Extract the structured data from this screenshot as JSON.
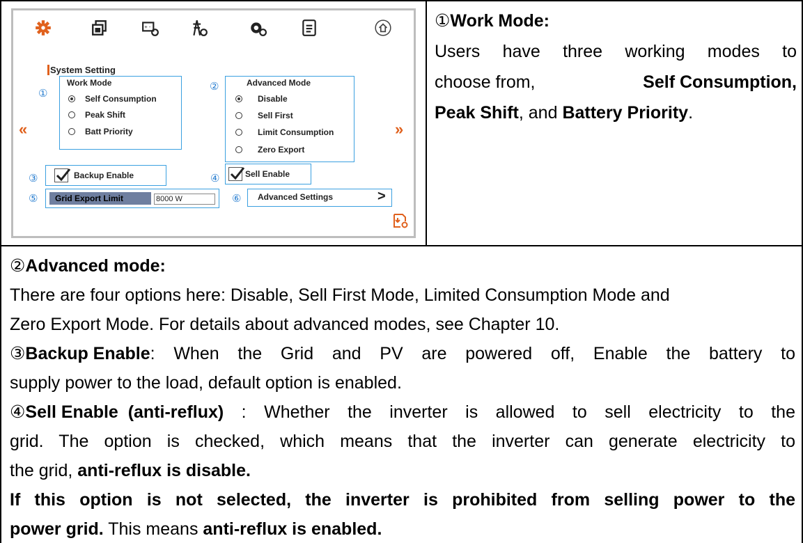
{
  "device": {
    "toolbar_icons": [
      "gear-icon",
      "copy-settings-icon",
      "battery-settings-icon",
      "grid-tower-icon",
      "generator-icon",
      "document-icon",
      "home-icon"
    ],
    "section_title": "System Setting",
    "work_mode": {
      "number": "①",
      "title": "Work Mode",
      "options": [
        "Self Consumption",
        "Peak Shift",
        "Batt Priority"
      ],
      "selected": "Self Consumption"
    },
    "advanced_mode": {
      "number": "②",
      "title": "Advanced Mode",
      "options": [
        "Disable",
        "Sell First",
        "Limit Consumption",
        "Zero Export"
      ],
      "selected": "Disable"
    },
    "prev_arrow": "«",
    "next_arrow": "»",
    "backup": {
      "number": "③",
      "label": "Backup Enable",
      "checked": true
    },
    "sell": {
      "number": "④",
      "label": "Sell Enable",
      "checked": true
    },
    "grid_limit": {
      "number": "⑤",
      "label": "Grid Export Limit",
      "value": "8000 W"
    },
    "advanced_settings": {
      "number": "⑥",
      "label": "Advanced Settings",
      "chevron": ">"
    },
    "accent_color": "#e0611d",
    "box_color": "#3aa0e0"
  },
  "right_panel": {
    "heading_num": "①",
    "heading": "Work Mode:",
    "line1": "Users have three working modes to",
    "line2_pre": "choose from, ",
    "line2_bold": "Self Consumption,",
    "line3_bold1": "Peak Shift",
    "line3_mid": ", and ",
    "line3_bold2": "Battery Priority",
    "line3_end": "."
  },
  "bottom": {
    "adv_num": "②",
    "adv_heading": "Advanced mode:",
    "adv_line1": "There are four options here: Disable, Sell First Mode, Limited Consumption Mode and",
    "adv_line2": "Zero Export Mode. For details about advanced modes, see Chapter 10.",
    "backup_num": "③",
    "backup_heading": "Backup Enable",
    "backup_text1": ": When the Grid and PV are powered off, Enable the battery to",
    "backup_text2": "supply power to the load, default option is enabled.",
    "sell_num": "④",
    "sell_heading": "Sell Enable  (anti-reflux)",
    "sell_text1": " : Whether the inverter is allowed to sell electricity to the",
    "sell_text2": "grid. The option is checked, which means that the inverter can generate electricity to",
    "sell_text3_pre": "the grid, ",
    "sell_text3_bold": "anti-reflux is disable.",
    "warn_bold1": "If this option is not selected, the inverter is prohibited from selling power to the",
    "warn_bold2": "power grid.",
    "warn_mid": " This means ",
    "warn_bold3": "anti-reflux is enabled."
  }
}
